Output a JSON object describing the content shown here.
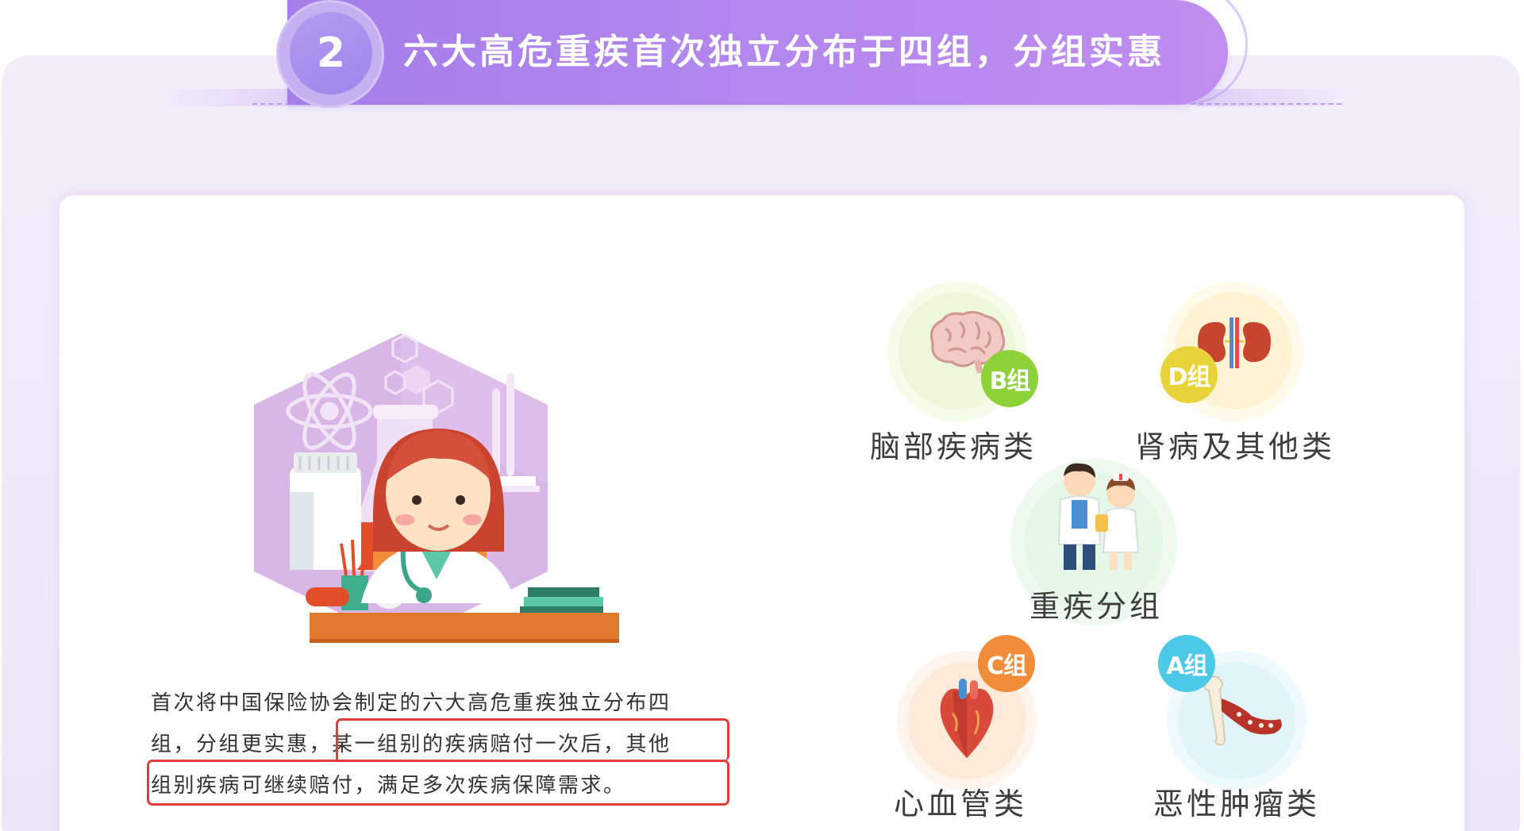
{
  "banner": {
    "number": "2",
    "title": "六大高危重疾首次独立分布于四组，分组实惠"
  },
  "paragraph": {
    "line1": "首次将中国保险协会制定的六大高危重疾独立分布四",
    "line2_a": "组，分组更实惠，",
    "line2_b": "某一组别的疾病赔付一次后，其他",
    "line3": "组别疾病可继续赔付，满足多次疾病保障需求。"
  },
  "groups": {
    "center": {
      "label": "重疾分组"
    },
    "b": {
      "tag": "B组",
      "label": "脑部疾病类",
      "color": "#8ed23a"
    },
    "d": {
      "tag": "D组",
      "label": "肾病及其他类",
      "color": "#e9d33a"
    },
    "c": {
      "tag": "C组",
      "label": "心血管类",
      "color": "#f08c3a"
    },
    "a": {
      "tag": "A组",
      "label": "恶性肿瘤类",
      "color": "#4cc9e6"
    }
  },
  "colors": {
    "banner_start": "#a57ee9",
    "banner_end": "#c08df0",
    "highlight_border": "#e73c3c"
  },
  "icons": {
    "doctor": "doctor-illustration",
    "brain": "brain-icon",
    "kidney": "kidney-icon",
    "heart": "heart-icon",
    "bone": "bone-tumor-icon",
    "medical_staff": "medical-staff-icon"
  }
}
